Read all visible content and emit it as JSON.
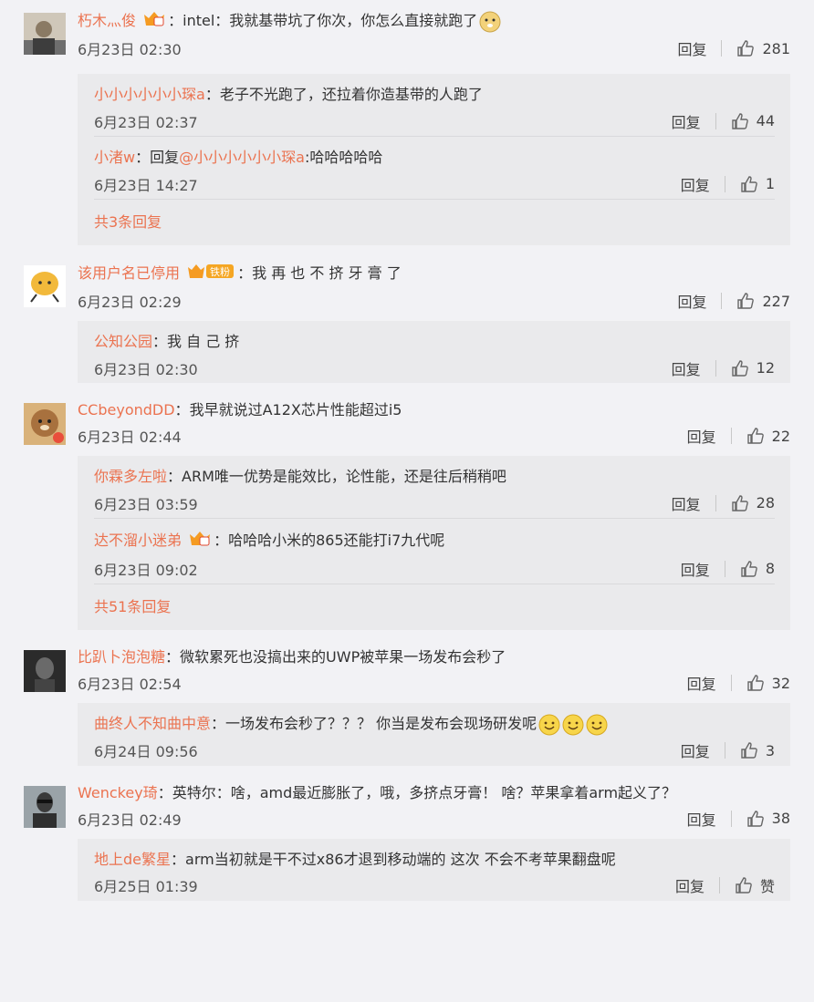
{
  "comments": [
    {
      "user": "朽木灬俊",
      "has_badge": true,
      "text": "intel：我就基带坑了你次，你怎么直接就跑了",
      "time": "6月23日 02:30",
      "reply_label": "回复",
      "likes": "281",
      "replies": [
        {
          "user": "小小小小小小琛a",
          "text": "老子不光跑了，还拉着你造基带的人跑了",
          "time": "6月23日 02:37",
          "reply_label": "回复",
          "likes": "44"
        },
        {
          "user": "小渚w",
          "text_prefix": "回复",
          "mention": "@小小小小小小琛a",
          "text": ":哈哈哈哈哈",
          "time": "6月23日 14:27",
          "reply_label": "回复",
          "likes": "1"
        }
      ],
      "more": "共3条回复"
    },
    {
      "user": "该用户名已停用",
      "has_badge": true,
      "badge_text": "铁粉",
      "text": "我 再 也 不 挤 牙 膏 了",
      "time": "6月23日 02:29",
      "reply_label": "回复",
      "likes": "227",
      "replies": [
        {
          "user": "公知公园",
          "text": "我 自 己 挤",
          "time": "6月23日 02:30",
          "reply_label": "回复",
          "likes": "12"
        }
      ]
    },
    {
      "user": "CCbeyondDD",
      "text": "我早就说过A12X芯片性能超过i5",
      "time": "6月23日 02:44",
      "reply_label": "回复",
      "likes": "22",
      "replies": [
        {
          "user": "你霖多左啦",
          "text": "ARM唯一优势是能效比，论性能，还是往后稍稍吧",
          "time": "6月23日 03:59",
          "reply_label": "回复",
          "likes": "28"
        },
        {
          "user": "达不溜小迷弟",
          "text": "哈哈哈小米的865还能打i7九代呢",
          "time": "6月23日 09:02",
          "reply_label": "回复",
          "likes": "8"
        }
      ],
      "more": "共51条回复"
    },
    {
      "user": "比趴卜泡泡糖",
      "text": "微软累死也没搞出来的UWP被苹果一场发布会秒了",
      "time": "6月23日 02:54",
      "reply_label": "回复",
      "likes": "32",
      "replies": [
        {
          "user": "曲终人不知曲中意",
          "text": "一场发布会秒了？？？ 你当是发布会现场研发呢",
          "time": "6月24日 09:56",
          "reply_label": "回复",
          "likes": "3"
        }
      ]
    },
    {
      "user": "Wenckey琦",
      "text": "英特尔：啥，amd最近膨胀了，哦，多挤点牙膏！ 啥？苹果拿着arm起义了？",
      "time": "6月23日 02:49",
      "reply_label": "回复",
      "likes": "38",
      "replies": [
        {
          "user": "地上de繁星",
          "text": "arm当初就是干不过x86才退到移动端的 这次 不会不考苹果翻盘呢",
          "time": "6月25日 01:39",
          "reply_label": "回复",
          "likes": "赞"
        }
      ]
    }
  ]
}
